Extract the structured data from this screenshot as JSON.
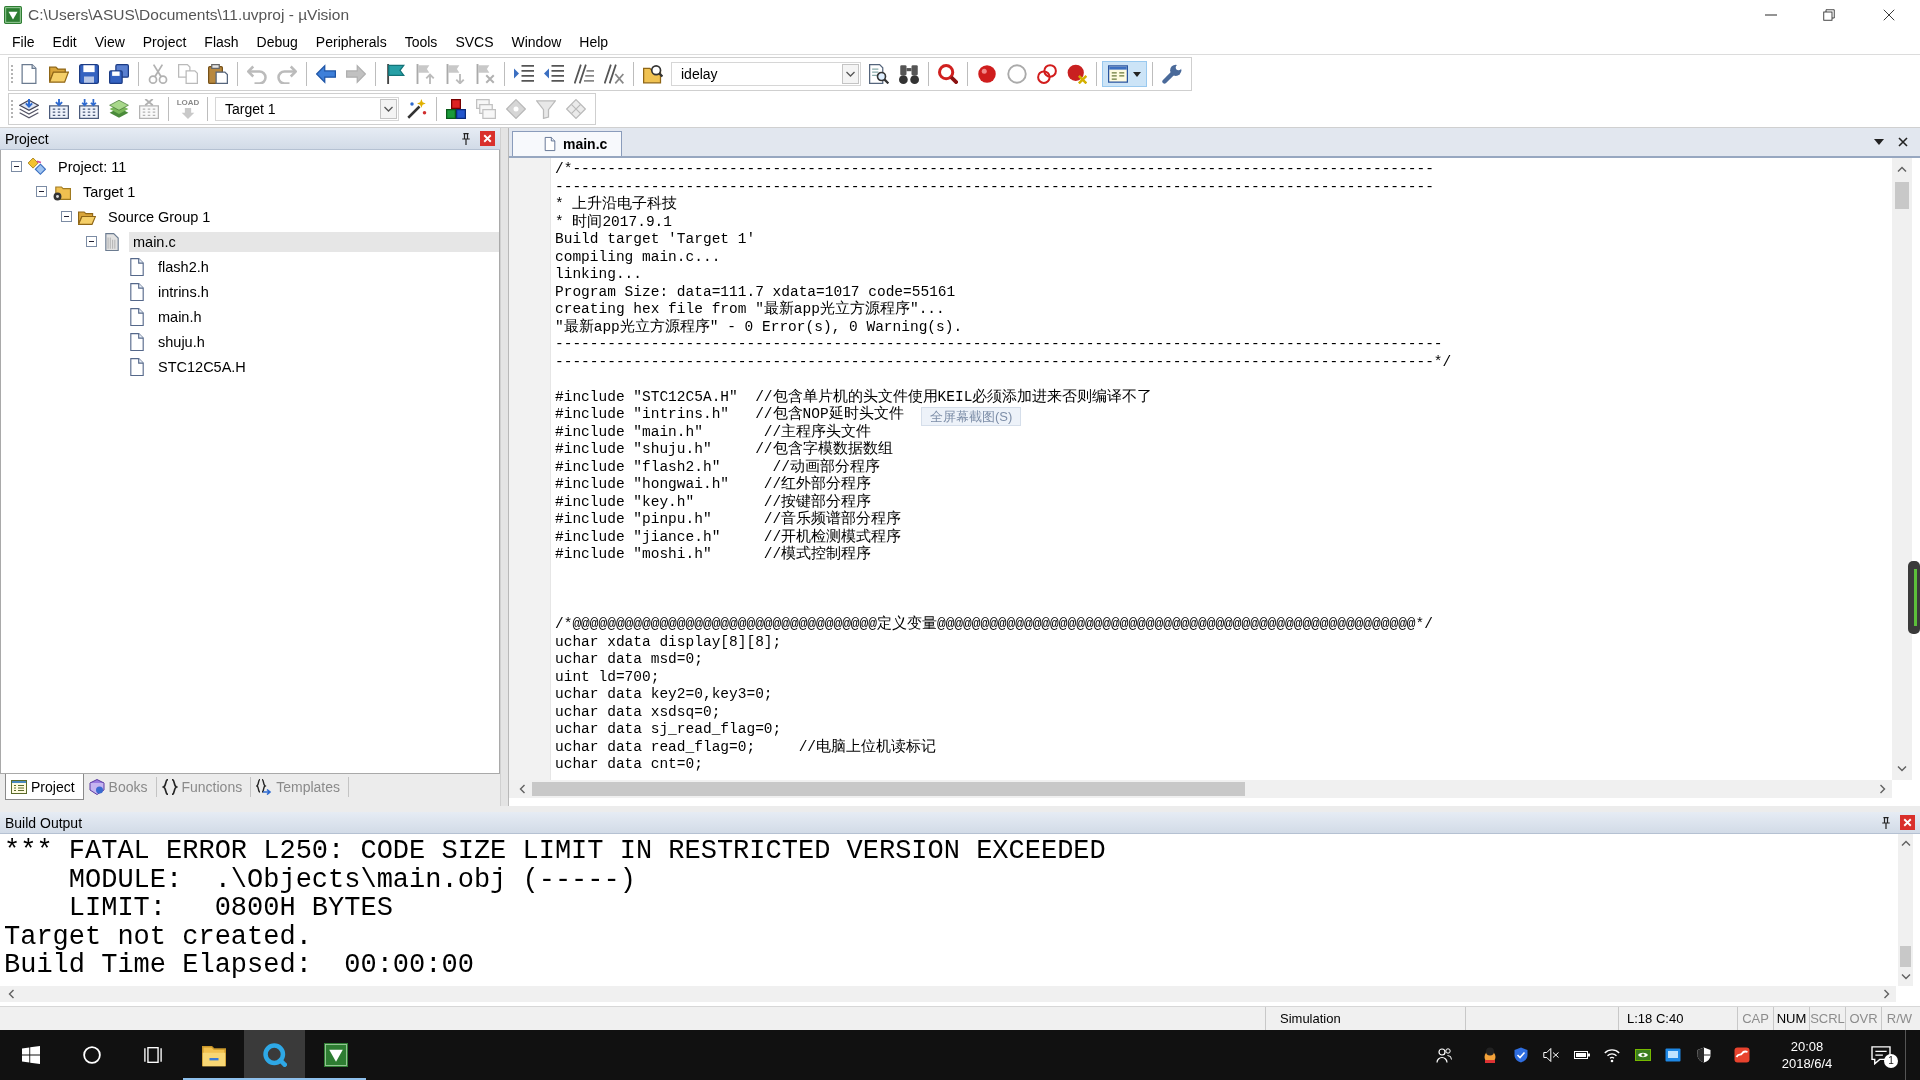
{
  "window": {
    "title": "C:\\Users\\ASUS\\Documents\\11.uvproj - µVision"
  },
  "menu": [
    "File",
    "Edit",
    "View",
    "Project",
    "Flash",
    "Debug",
    "Peripherals",
    "Tools",
    "SVCS",
    "Window",
    "Help"
  ],
  "toolbars": [
    {
      "items": [
        {
          "kind": "button",
          "disabled": false,
          "pressed": false
        },
        {
          "kind": "button",
          "disabled": false,
          "pressed": false
        },
        {
          "kind": "button",
          "disabled": false,
          "pressed": false
        },
        {
          "kind": "button",
          "disabled": false,
          "pressed": false
        },
        {
          "kind": "separator"
        },
        {
          "kind": "button",
          "disabled": true,
          "pressed": false
        },
        {
          "kind": "button",
          "disabled": true,
          "pressed": false
        },
        {
          "kind": "button",
          "disabled": false,
          "pressed": false
        },
        {
          "kind": "separator"
        },
        {
          "kind": "button",
          "disabled": true,
          "pressed": false
        },
        {
          "kind": "button",
          "disabled": true,
          "pressed": false
        },
        {
          "kind": "separator"
        },
        {
          "kind": "button",
          "disabled": false,
          "pressed": false
        },
        {
          "kind": "button",
          "disabled": true,
          "pressed": false
        },
        {
          "kind": "separator"
        },
        {
          "kind": "button",
          "disabled": false,
          "pressed": false
        },
        {
          "kind": "button",
          "disabled": true,
          "pressed": false
        },
        {
          "kind": "button",
          "disabled": true,
          "pressed": false
        },
        {
          "kind": "button",
          "disabled": true,
          "pressed": false
        },
        {
          "kind": "separator"
        },
        {
          "kind": "button",
          "disabled": false,
          "pressed": false
        },
        {
          "kind": "button",
          "disabled": false,
          "pressed": false
        },
        {
          "kind": "button",
          "disabled": false,
          "pressed": false
        },
        {
          "kind": "button",
          "disabled": false,
          "pressed": false
        },
        {
          "kind": "separator"
        },
        {
          "kind": "button",
          "disabled": false,
          "pressed": false
        },
        {
          "kind": "combo",
          "value": "idelay"
        },
        {
          "kind": "button",
          "disabled": false,
          "pressed": false
        },
        {
          "kind": "button",
          "disabled": false,
          "pressed": false
        },
        {
          "kind": "separator"
        },
        {
          "kind": "button",
          "disabled": false,
          "pressed": false
        },
        {
          "kind": "separator"
        },
        {
          "kind": "button",
          "disabled": false,
          "pressed": false
        },
        {
          "kind": "button",
          "disabled": false,
          "pressed": false
        },
        {
          "kind": "button",
          "disabled": false,
          "pressed": false
        },
        {
          "kind": "button",
          "disabled": false,
          "pressed": false
        },
        {
          "kind": "separator"
        },
        {
          "kind": "menu_button",
          "disabled": false,
          "pressed": true
        },
        {
          "kind": "separator"
        },
        {
          "kind": "button",
          "disabled": false,
          "pressed": false
        }
      ]
    },
    {
      "items": [
        {
          "kind": "button",
          "disabled": false,
          "pressed": false
        },
        {
          "kind": "button",
          "disabled": false,
          "pressed": false
        },
        {
          "kind": "button",
          "disabled": false,
          "pressed": false
        },
        {
          "kind": "button",
          "disabled": false,
          "pressed": false
        },
        {
          "kind": "button",
          "disabled": true,
          "pressed": false
        },
        {
          "kind": "separator"
        },
        {
          "kind": "button",
          "label": "LOAD",
          "disabled": true,
          "pressed": false
        },
        {
          "kind": "separator"
        },
        {
          "kind": "combo",
          "value": "Target 1"
        },
        {
          "kind": "button",
          "disabled": false,
          "pressed": false
        },
        {
          "kind": "separator"
        },
        {
          "kind": "button",
          "disabled": false,
          "pressed": false
        },
        {
          "kind": "button",
          "disabled": true,
          "pressed": false
        },
        {
          "kind": "button",
          "disabled": true,
          "pressed": false
        },
        {
          "kind": "button",
          "disabled": true,
          "pressed": false
        },
        {
          "kind": "button",
          "disabled": true,
          "pressed": false
        }
      ]
    }
  ],
  "project_panel": {
    "title": "Project",
    "tree": [
      {
        "kind": "project",
        "label": "Project: 11",
        "expanded": true,
        "selected": false,
        "children": [
          {
            "kind": "target",
            "label": "Target 1",
            "expanded": true,
            "selected": false,
            "children": [
              {
                "kind": "group",
                "label": "Source Group 1",
                "expanded": true,
                "selected": false,
                "children": [
                  {
                    "kind": "source",
                    "label": "main.c",
                    "expanded": true,
                    "selected": true,
                    "children": [
                      {
                        "kind": "file",
                        "label": "flash2.h",
                        "selected": false
                      },
                      {
                        "kind": "file",
                        "label": "intrins.h",
                        "selected": false
                      },
                      {
                        "kind": "file",
                        "label": "main.h",
                        "selected": false
                      },
                      {
                        "kind": "file",
                        "label": "shuju.h",
                        "selected": false
                      },
                      {
                        "kind": "file",
                        "label": "STC12C5A.H",
                        "selected": false
                      }
                    ]
                  }
                ]
              }
            ]
          }
        ]
      }
    ],
    "tabs": [
      {
        "label": "Project",
        "selected": true
      },
      {
        "label": "Books",
        "selected": false
      },
      {
        "label": "Functions",
        "selected": false
      },
      {
        "label": "Templates",
        "selected": false
      }
    ]
  },
  "editor": {
    "tabs": [
      {
        "label": "main.c",
        "selected": true
      }
    ],
    "lines": [
      {
        "kind": "code",
        "text": "/*---------------------------------------------------------------------------------------------------"
      },
      {
        "kind": "code",
        "text": "-----------------------------------------------------------------------------------------------------"
      },
      {
        "kind": "code",
        "text": "* 上升沿电子科技"
      },
      {
        "kind": "code",
        "text": "* 时间2017.9.1"
      },
      {
        "kind": "code",
        "text": "Build target 'Target 1'"
      },
      {
        "kind": "code",
        "text": "compiling main.c..."
      },
      {
        "kind": "code",
        "text": "linking..."
      },
      {
        "kind": "code",
        "text": "Program Size: data=111.7 xdata=1017 code=55161"
      },
      {
        "kind": "code",
        "text": "creating hex file from \"最新app光立方源程序\"..."
      },
      {
        "kind": "code",
        "text": "\"最新app光立方源程序\" - 0 Error(s), 0 Warning(s)."
      },
      {
        "kind": "code",
        "text": "------------------------------------------------------------------------------------------------------"
      },
      {
        "kind": "code",
        "text": "-----------------------------------------------------------------------------------------------------*/"
      },
      {
        "kind": "blank"
      },
      {
        "kind": "code",
        "text": "#include \"STC12C5A.H\"  //包含单片机的头文件使用KEIL必须添加进来否则编译不了"
      },
      {
        "kind": "code",
        "text": "#include \"intrins.h\"   //包含NOP延时头文件"
      },
      {
        "kind": "code",
        "text": "#include \"main.h\"       //主程序头文件"
      },
      {
        "kind": "code",
        "text": "#include \"shuju.h\"     //包含字模数据数组"
      },
      {
        "kind": "code",
        "text": "#include \"flash2.h\"      //动画部分程序"
      },
      {
        "kind": "code",
        "text": "#include \"hongwai.h\"    //红外部分程序"
      },
      {
        "kind": "code",
        "text": "#include \"key.h\"        //按键部分程序"
      },
      {
        "kind": "code",
        "text": "#include \"pinpu.h\"      //音乐频谱部分程序"
      },
      {
        "kind": "code",
        "text": "#include \"jiance.h\"     //开机检测模式程序"
      },
      {
        "kind": "code",
        "text": "#include \"moshi.h\"      //模式控制程序"
      },
      {
        "kind": "blank"
      },
      {
        "kind": "blank"
      },
      {
        "kind": "blank"
      },
      {
        "kind": "code",
        "text": "/*@@@@@@@@@@@@@@@@@@@@@@@@@@@@@@@@@@@定义变量@@@@@@@@@@@@@@@@@@@@@@@@@@@@@@@@@@@@@@@@@@@@@@@@@@@@@@@*/"
      },
      {
        "kind": "code",
        "text": "uchar xdata display[8][8];"
      },
      {
        "kind": "code",
        "text": "uchar data msd=0;"
      },
      {
        "kind": "code",
        "text": "uint ld=700;"
      },
      {
        "kind": "code",
        "text": "uchar data key2=0,key3=0;"
      },
      {
        "kind": "code",
        "text": "uchar data xsdsq=0;"
      },
      {
        "kind": "code",
        "text": "uchar data sj_read_flag=0;"
      },
      {
        "kind": "code",
        "text": "uchar data read_flag=0;     //电脑上位机读标记"
      },
      {
        "kind": "code",
        "text": "uchar data cnt=0;"
      }
    ],
    "tooltip": {
      "text": "全屏幕截图(S)"
    }
  },
  "build_output": {
    "title": "Build Output",
    "lines": [
      "*** FATAL ERROR L250: CODE SIZE LIMIT IN RESTRICTED VERSION EXCEEDED",
      "    MODULE:  .\\Objects\\main.obj (-----)",
      "    LIMIT:   0800H BYTES",
      "Target not created.",
      "Build Time Elapsed:  00:00:00"
    ]
  },
  "status_bar": {
    "mode": "Simulation",
    "position": "L:18 C:40",
    "indicators": [
      {
        "label": "CAP",
        "on": false
      },
      {
        "label": "NUM",
        "on": true
      },
      {
        "label": "SCRL",
        "on": false
      },
      {
        "label": "OVR",
        "on": false
      },
      {
        "label": "R/W",
        "on": false
      }
    ]
  },
  "taskbar": {
    "buttons": [
      {
        "kind": "start"
      },
      {
        "kind": "search"
      },
      {
        "kind": "task_view"
      }
    ],
    "apps": [
      {
        "kind": "folder",
        "running": true,
        "active": false
      },
      {
        "kind": "ring",
        "running": true,
        "active": true
      },
      {
        "kind": "tile",
        "running": true,
        "active": false
      }
    ],
    "tray": [
      {
        "kind": "people"
      },
      {
        "kind": "figure"
      },
      {
        "kind": "shield_check"
      },
      {
        "kind": "speaker_muted"
      },
      {
        "kind": "battery"
      },
      {
        "kind": "wifi"
      },
      {
        "kind": "eye_tile"
      },
      {
        "kind": "window_tile"
      },
      {
        "kind": "shield"
      },
      {
        "kind": "wave_tile"
      }
    ],
    "time": "20:08",
    "date": "2018/6/4",
    "notifications": "1"
  }
}
